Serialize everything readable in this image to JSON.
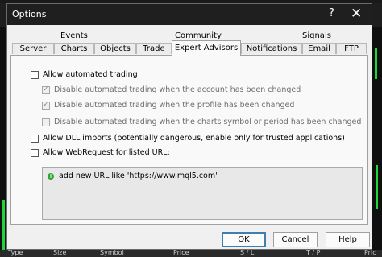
{
  "window": {
    "title": "Options",
    "help_symbol": "?",
    "close_symbol": "✕"
  },
  "tabs_row1": [
    {
      "label": "Events"
    },
    {
      "label": "Community"
    },
    {
      "label": "Signals"
    }
  ],
  "tabs_row2": [
    {
      "label": "Server"
    },
    {
      "label": "Charts"
    },
    {
      "label": "Objects"
    },
    {
      "label": "Trade"
    },
    {
      "label": "Expert Advisors",
      "active": true
    },
    {
      "label": "Notifications"
    },
    {
      "label": "Email"
    },
    {
      "label": "FTP"
    }
  ],
  "options": {
    "allow_automated_trading": {
      "label": "Allow automated trading",
      "checked": false
    },
    "disable_on_account_change": {
      "label": "Disable automated trading when the account has been changed",
      "checked": true,
      "enabled": false
    },
    "disable_on_profile_change": {
      "label": "Disable automated trading when the profile has been changed",
      "checked": true,
      "enabled": false
    },
    "disable_on_symbol_change": {
      "label": "Disable automated trading when the charts symbol or period has been changed",
      "checked": false,
      "enabled": false
    },
    "allow_dll_imports": {
      "label": "Allow DLL imports (potentially dangerous, enable only for trusted applications)",
      "checked": false
    },
    "allow_webrequest": {
      "label": "Allow WebRequest for listed URL:",
      "checked": false
    }
  },
  "url_list": {
    "add_label": "add new URL like 'https://www.mql5.com'"
  },
  "buttons": {
    "ok": "OK",
    "cancel": "Cancel",
    "help": "Help"
  },
  "bottom_columns": [
    "Type",
    "Size",
    "Symbol",
    "Price",
    "S / L",
    "T / P",
    "Pric"
  ],
  "colors": {
    "titlebar": "#1f1f1f",
    "accent_border": "#3c7fb1",
    "chart_green": "#1dd43a"
  }
}
